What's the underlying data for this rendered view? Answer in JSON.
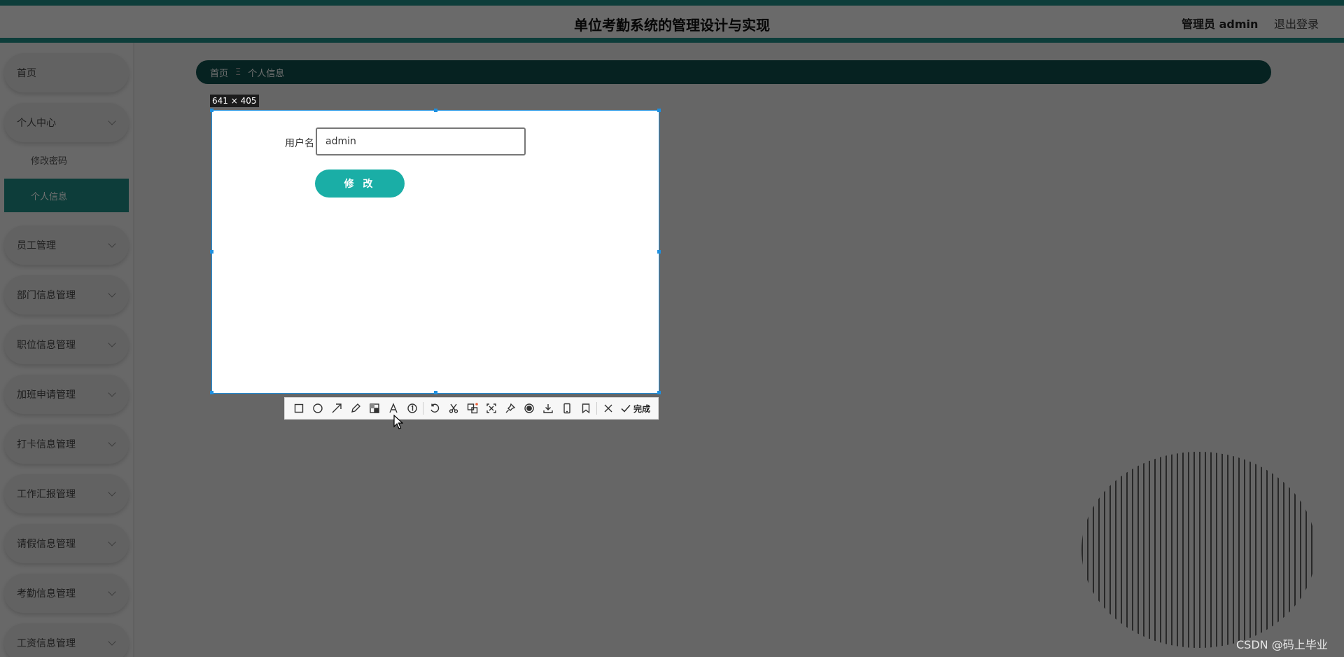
{
  "header": {
    "title": "单位考勤系统的管理设计与实现",
    "admin_label": "管理员 admin",
    "logout_label": "退出登录"
  },
  "sidebar": {
    "items": [
      {
        "label": "首页"
      },
      {
        "label": "个人中心"
      },
      {
        "label": "修改密码"
      },
      {
        "label": "个人信息"
      },
      {
        "label": "员工管理"
      },
      {
        "label": "部门信息管理"
      },
      {
        "label": "职位信息管理"
      },
      {
        "label": "加班申请管理"
      },
      {
        "label": "打卡信息管理"
      },
      {
        "label": "工作汇报管理"
      },
      {
        "label": "请假信息管理"
      },
      {
        "label": "考勤信息管理"
      },
      {
        "label": "工资信息管理"
      }
    ]
  },
  "breadcrumb": {
    "home": "首页",
    "separator": "Ξ",
    "current": "个人信息"
  },
  "form": {
    "username_label": "用户名",
    "username_value": "admin",
    "submit_label": "修 改"
  },
  "capture": {
    "size_label": "641 × 405"
  },
  "toolbar": {
    "tools": [
      "rectangle-icon",
      "ellipse-icon",
      "arrow-icon",
      "pencil-icon",
      "mosaic-icon",
      "text-icon",
      "number-icon",
      "undo-icon",
      "scissors-icon",
      "translate-icon",
      "scan-icon",
      "pin-icon",
      "record-icon",
      "download-icon",
      "phone-icon",
      "bookmark-icon",
      "cancel-icon"
    ],
    "done_label": "完成"
  },
  "watermark": "CSDN @码上毕业",
  "colors": {
    "accent": "#1f8c84",
    "breadcrumb_bg": "#0f4f4b",
    "button": "#1aaea6",
    "selection_border": "#1e90e0"
  }
}
